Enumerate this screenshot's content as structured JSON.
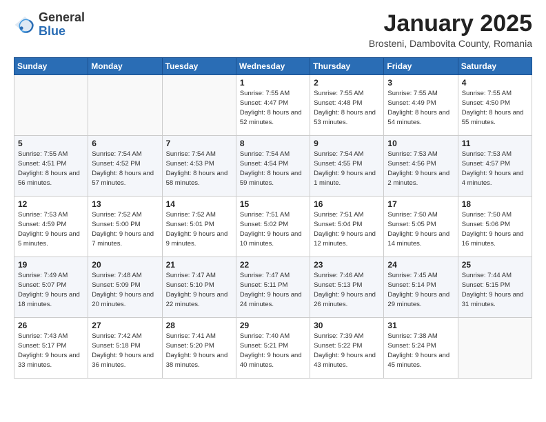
{
  "header": {
    "logo_general": "General",
    "logo_blue": "Blue",
    "month_title": "January 2025",
    "location": "Brosteni, Dambovita County, Romania"
  },
  "weekdays": [
    "Sunday",
    "Monday",
    "Tuesday",
    "Wednesday",
    "Thursday",
    "Friday",
    "Saturday"
  ],
  "weeks": [
    [
      {
        "day": "",
        "info": ""
      },
      {
        "day": "",
        "info": ""
      },
      {
        "day": "",
        "info": ""
      },
      {
        "day": "1",
        "info": "Sunrise: 7:55 AM\nSunset: 4:47 PM\nDaylight: 8 hours and 52 minutes."
      },
      {
        "day": "2",
        "info": "Sunrise: 7:55 AM\nSunset: 4:48 PM\nDaylight: 8 hours and 53 minutes."
      },
      {
        "day": "3",
        "info": "Sunrise: 7:55 AM\nSunset: 4:49 PM\nDaylight: 8 hours and 54 minutes."
      },
      {
        "day": "4",
        "info": "Sunrise: 7:55 AM\nSunset: 4:50 PM\nDaylight: 8 hours and 55 minutes."
      }
    ],
    [
      {
        "day": "5",
        "info": "Sunrise: 7:55 AM\nSunset: 4:51 PM\nDaylight: 8 hours and 56 minutes."
      },
      {
        "day": "6",
        "info": "Sunrise: 7:54 AM\nSunset: 4:52 PM\nDaylight: 8 hours and 57 minutes."
      },
      {
        "day": "7",
        "info": "Sunrise: 7:54 AM\nSunset: 4:53 PM\nDaylight: 8 hours and 58 minutes."
      },
      {
        "day": "8",
        "info": "Sunrise: 7:54 AM\nSunset: 4:54 PM\nDaylight: 8 hours and 59 minutes."
      },
      {
        "day": "9",
        "info": "Sunrise: 7:54 AM\nSunset: 4:55 PM\nDaylight: 9 hours and 1 minute."
      },
      {
        "day": "10",
        "info": "Sunrise: 7:53 AM\nSunset: 4:56 PM\nDaylight: 9 hours and 2 minutes."
      },
      {
        "day": "11",
        "info": "Sunrise: 7:53 AM\nSunset: 4:57 PM\nDaylight: 9 hours and 4 minutes."
      }
    ],
    [
      {
        "day": "12",
        "info": "Sunrise: 7:53 AM\nSunset: 4:59 PM\nDaylight: 9 hours and 5 minutes."
      },
      {
        "day": "13",
        "info": "Sunrise: 7:52 AM\nSunset: 5:00 PM\nDaylight: 9 hours and 7 minutes."
      },
      {
        "day": "14",
        "info": "Sunrise: 7:52 AM\nSunset: 5:01 PM\nDaylight: 9 hours and 9 minutes."
      },
      {
        "day": "15",
        "info": "Sunrise: 7:51 AM\nSunset: 5:02 PM\nDaylight: 9 hours and 10 minutes."
      },
      {
        "day": "16",
        "info": "Sunrise: 7:51 AM\nSunset: 5:04 PM\nDaylight: 9 hours and 12 minutes."
      },
      {
        "day": "17",
        "info": "Sunrise: 7:50 AM\nSunset: 5:05 PM\nDaylight: 9 hours and 14 minutes."
      },
      {
        "day": "18",
        "info": "Sunrise: 7:50 AM\nSunset: 5:06 PM\nDaylight: 9 hours and 16 minutes."
      }
    ],
    [
      {
        "day": "19",
        "info": "Sunrise: 7:49 AM\nSunset: 5:07 PM\nDaylight: 9 hours and 18 minutes."
      },
      {
        "day": "20",
        "info": "Sunrise: 7:48 AM\nSunset: 5:09 PM\nDaylight: 9 hours and 20 minutes."
      },
      {
        "day": "21",
        "info": "Sunrise: 7:47 AM\nSunset: 5:10 PM\nDaylight: 9 hours and 22 minutes."
      },
      {
        "day": "22",
        "info": "Sunrise: 7:47 AM\nSunset: 5:11 PM\nDaylight: 9 hours and 24 minutes."
      },
      {
        "day": "23",
        "info": "Sunrise: 7:46 AM\nSunset: 5:13 PM\nDaylight: 9 hours and 26 minutes."
      },
      {
        "day": "24",
        "info": "Sunrise: 7:45 AM\nSunset: 5:14 PM\nDaylight: 9 hours and 29 minutes."
      },
      {
        "day": "25",
        "info": "Sunrise: 7:44 AM\nSunset: 5:15 PM\nDaylight: 9 hours and 31 minutes."
      }
    ],
    [
      {
        "day": "26",
        "info": "Sunrise: 7:43 AM\nSunset: 5:17 PM\nDaylight: 9 hours and 33 minutes."
      },
      {
        "day": "27",
        "info": "Sunrise: 7:42 AM\nSunset: 5:18 PM\nDaylight: 9 hours and 36 minutes."
      },
      {
        "day": "28",
        "info": "Sunrise: 7:41 AM\nSunset: 5:20 PM\nDaylight: 9 hours and 38 minutes."
      },
      {
        "day": "29",
        "info": "Sunrise: 7:40 AM\nSunset: 5:21 PM\nDaylight: 9 hours and 40 minutes."
      },
      {
        "day": "30",
        "info": "Sunrise: 7:39 AM\nSunset: 5:22 PM\nDaylight: 9 hours and 43 minutes."
      },
      {
        "day": "31",
        "info": "Sunrise: 7:38 AM\nSunset: 5:24 PM\nDaylight: 9 hours and 45 minutes."
      },
      {
        "day": "",
        "info": ""
      }
    ]
  ]
}
